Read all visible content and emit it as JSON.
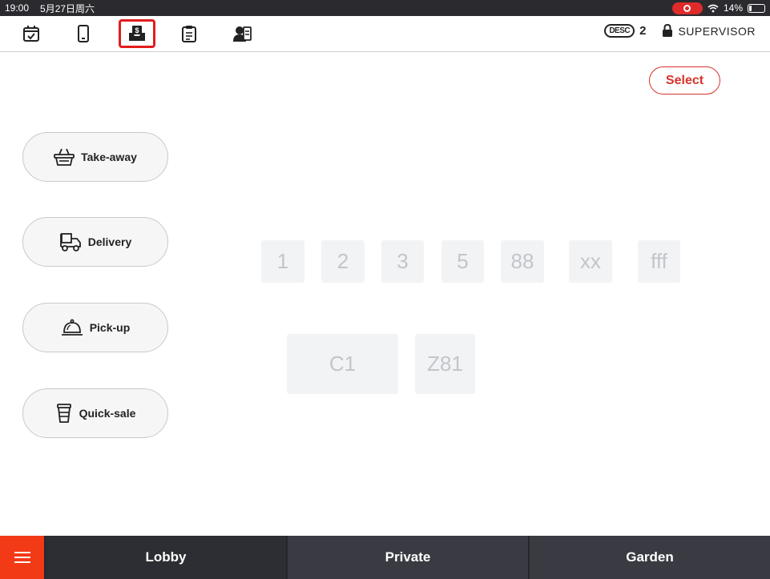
{
  "status_bar": {
    "time": "19:00",
    "date": "5月27日周六",
    "battery": "14%"
  },
  "toolbar": {
    "icons": [
      "calendar-check-icon",
      "tablet-icon",
      "cash-drawer-icon",
      "clipboard-icon",
      "staff-card-icon"
    ],
    "active_index": 2,
    "desc_label": "DESC",
    "desc_count": "2",
    "user_role": "SUPERVISOR"
  },
  "actions": {
    "select_label": "Select"
  },
  "modes": [
    {
      "label": "Take-away",
      "icon": "basket-icon"
    },
    {
      "label": "Delivery",
      "icon": "delivery-cart-icon"
    },
    {
      "label": "Pick-up",
      "icon": "service-bell-icon"
    },
    {
      "label": "Quick-sale",
      "icon": "cup-icon"
    }
  ],
  "tables": [
    "1",
    "2",
    "3",
    "5",
    "88",
    "xx",
    "fff",
    "C1",
    "Z81"
  ],
  "bottom_bar": {
    "tabs": [
      "Lobby",
      "Private",
      "Garden"
    ],
    "active_tab": "Lobby"
  },
  "colors": {
    "accent": "#d6332b",
    "menu": "#f23a16",
    "bottom_bar": "#3a3b42",
    "table_tile": "#f2f3f5"
  }
}
